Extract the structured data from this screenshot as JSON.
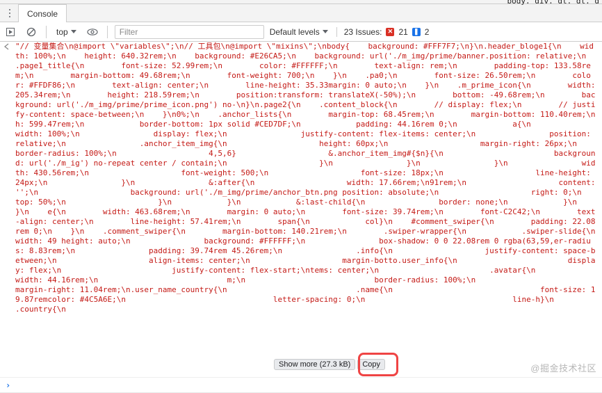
{
  "fragment": "body. div. dt. dt. d",
  "tab": {
    "label": "Console"
  },
  "toolbar": {
    "top_label": "top",
    "filter_placeholder": "Filter",
    "levels_label": "Default levels",
    "issues_label": "23 Issues:",
    "issues_err_count": "21",
    "issues_info_count": "2"
  },
  "log": {
    "gutter": "''",
    "show_more": "Show more (27.3 kB)",
    "copy": "Copy",
    "text": "\"// 变量集合\\n@import \\\"variables\\\";\\n// 工具包\\n@import \\\"mixins\\\";\\nbody{    background: #FFF7F7;\\n}\\n.header_bloge1{\\n    width: 100%;\\n    height: 640.32rem;\\n    background: #E26CA5;\\n    background: url('./m_img/prime/banner.position: relative;\\n    .page1_title{\\n        font-size: 52.99rem;\\n        color: #FFFFFF;\\n        text-align: rem;\\n        padding-top: 133.58rem;\\n        margin-bottom: 49.68rem;\\n        font-weight: 700;\\n    }\\n    .pa0;\\n        font-size: 26.50rem;\\n        color: #FFDF86;\\n        text-align: center;\\n        line-height: 35.33margin: 0 auto;\\n    }\\n    .m_prime_icon{\\n        width: 205.34rem;\\n        height: 218.59rem;\\n        position:transform: translateX(-50%);\\n        bottom: -49.68rem;\\n        background: url('./m_img/prime/prime_icon.png') no-\\n}\\n.page2{\\n    .content_block{\\n        // display: flex;\\n        // justify-content: space-between;\\n    }\\n0%;\\n    .anchor_lists{\\n        margin-top: 68.45rem;\\n        margin-bottom: 110.40rem;\\n        h: 599.47rem;\\n            border-bottom: 1px solid #CED7DF;\\n            padding: 44.16rem 0;\\n            a{\\n                width: 100%;\\n                display: flex;\\n                justify-content: flex-items: center;\\n                position: relative;\\n                .anchor_item_img{\\n                    height: 60px;\\n                    margin-right: 26px;\\n                    border-radius: 100%;\\n                    4,5,6}                    &.anchor_item_img#{$n}{\\n                        background: url('./m_ig') no-repeat center / contain;\\n                    }\\n                }\\n                }\\n                width: 430.56rem;\\n                    font-weight: 500;\\n                    font-size: 18px;\\n                    line-height: 24px;\\n                }\\n                &:after{\\n                    width: 17.66rem;\\n91rem;\\n                    content: '';\\n                    background: url('./m_img/prime/anchor_btn.png position: absolute;\\n                    right: 0;\\n                    top: 50%;\\n                    }\\n            }\\n            &:last-child{\\n                border: none;\\n            }\\n        }\\n    e{\\n        width: 463.68rem;\\n        margin: 0 auto;\\n        font-size: 39.74rem;\\n        font-C2C42;\\n        text-align: center;\\n        line-height: 57.41rem;\\n        span{\\n            col}\\n    #comment_swiper{\\n        padding: 22.08rem 0;\\n    }\\n    .comment_swiper{\\n        margin-bottom: 140.21rem;\\n        .swiper-wrapper{\\n            .swiper-slide{\\n                width: 49 height: auto;\\n                background: #FFFFFF;\\n                box-shadow: 0 0 22.08rem 0 rgba(63,59,er-radius: 8.83rem;\\n                padding: 39.74rem 45.26rem;\\n                .info{\\n                    justify-content: space-between;\\n                    align-items: center;\\n                    margin-botto.user_info{\\n                        display: flex;\\n                        justify-content: flex-start;\\ntems: center;\\n                        .avatar{\\n                            width: 44.16rem;\\n                            m;\\n                            border-radius: 100%;\\n                            margin-right: 11.04rem;\\n.user_name_country{\\n                            .name{\\n                                font-size: 19.87remcolor: #4C5A6E;\\n                                letter-spacing: 0;\\n                                line-h}\\n                            .country{\\n"
  },
  "watermark": "@掘金技术社区"
}
